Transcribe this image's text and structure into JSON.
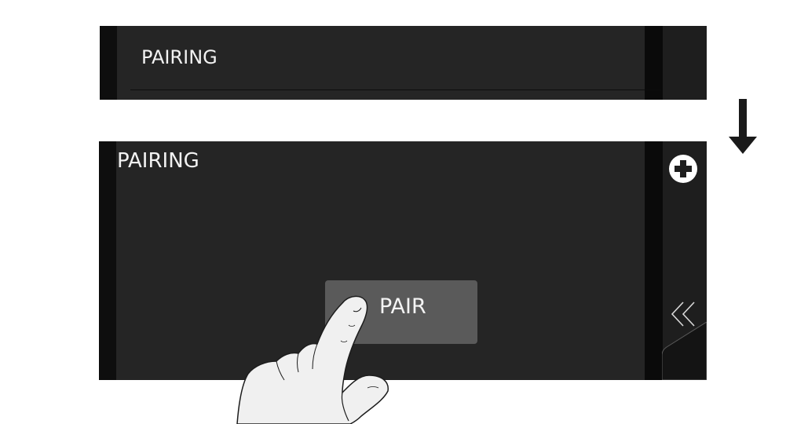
{
  "top_screen": {
    "title": "PAIRING"
  },
  "bottom_screen": {
    "title": "PAIRING",
    "pair_button_label": "PAIR",
    "add_icon": "plus-circle-icon",
    "back_icon": "double-chevron-left-icon"
  },
  "transition_icon": "arrow-down-icon",
  "gesture_icon": "finger-tap-icon",
  "colors": {
    "screen_bg": "#252525",
    "button_bg": "#5a5a5a",
    "text": "#f2f2f2"
  }
}
